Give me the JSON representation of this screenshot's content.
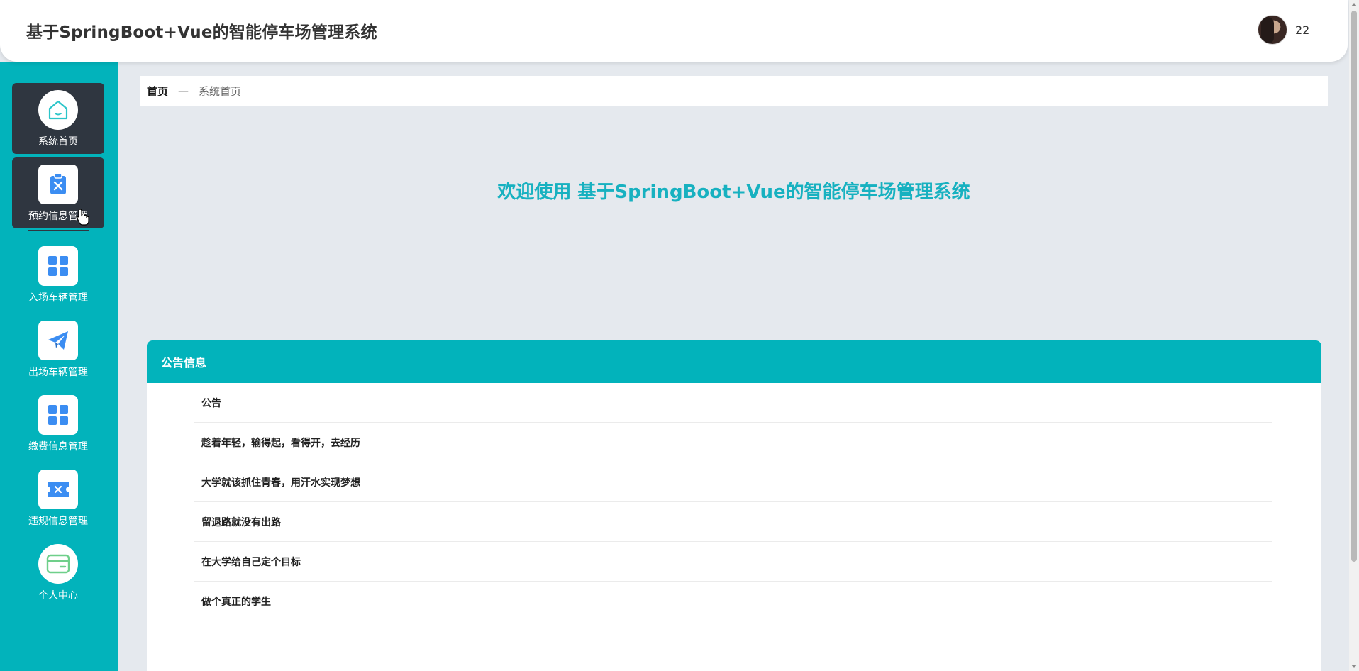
{
  "header": {
    "title": "基于SpringBoot+Vue的智能停车场管理系统",
    "username": "22"
  },
  "sidebar": {
    "items": [
      {
        "label": "系统首页",
        "icon": "home-icon"
      },
      {
        "label": "预约信息管理",
        "icon": "clipboard-x-icon"
      },
      {
        "label": "入场车辆管理",
        "icon": "grid-icon"
      },
      {
        "label": "出场车辆管理",
        "icon": "paper-plane-icon"
      },
      {
        "label": "缴费信息管理",
        "icon": "grid-icon"
      },
      {
        "label": "违规信息管理",
        "icon": "ticket-icon"
      },
      {
        "label": "个人中心",
        "icon": "card-icon"
      }
    ]
  },
  "breadcrumb": {
    "home": "首页",
    "separator": "—",
    "current": "系统首页"
  },
  "welcome": "欢迎使用 基于SpringBoot+Vue的智能停车场管理系统",
  "notice": {
    "title": "公告信息",
    "items": [
      "公告",
      "趁着年轻，输得起，看得开，去经历",
      "大学就该抓住青春，用汗水实现梦想",
      "留退路就没有出路",
      "在大学给自己定个目标",
      "做个真正的学生"
    ]
  },
  "colors": {
    "accent": "#02b3bb",
    "sidebar_active": "#2f3640",
    "welcome_text": "#17b1c0",
    "icon_blue": "#3b8df2"
  }
}
